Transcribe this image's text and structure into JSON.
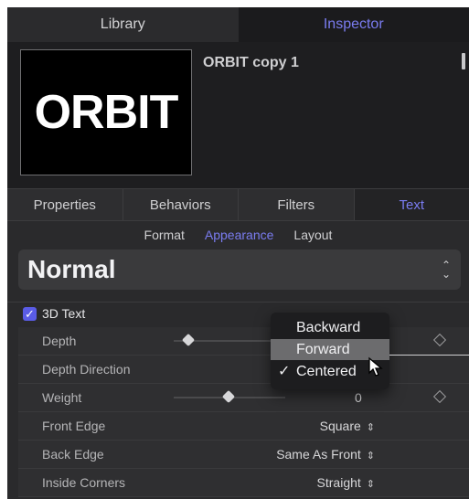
{
  "top_tabs": {
    "library": "Library",
    "inspector": "Inspector"
  },
  "header": {
    "thumbnail_text": "ORBIT",
    "object_name": "ORBIT copy 1"
  },
  "inspector_tabs": {
    "properties": "Properties",
    "behaviors": "Behaviors",
    "filters": "Filters",
    "text": "Text"
  },
  "subtabs": {
    "format": "Format",
    "appearance": "Appearance",
    "layout": "Layout"
  },
  "preset": {
    "label": "Normal"
  },
  "section": {
    "label": "3D Text"
  },
  "rows": {
    "depth": {
      "label": "Depth"
    },
    "depth_direction": {
      "label": "Depth Direction"
    },
    "weight": {
      "label": "Weight",
      "value": "0"
    },
    "front_edge": {
      "label": "Front Edge",
      "value": "Square"
    },
    "back_edge": {
      "label": "Back Edge",
      "value": "Same As Front"
    },
    "inside_corners": {
      "label": "Inside Corners",
      "value": "Straight"
    }
  },
  "menu": {
    "items": [
      "Backward",
      "Forward",
      "Centered"
    ],
    "checked": "✓"
  },
  "icons": {
    "pin": "pin-icon",
    "updown": "updown-icon",
    "checkbox": "checkbox-icon",
    "keyframe": "keyframe-diamond-icon",
    "cursor": "cursor-icon"
  },
  "colors": {
    "accent": "#7a7cf0",
    "panel": "#2a2a2c",
    "selection": "#6c6c6e"
  }
}
